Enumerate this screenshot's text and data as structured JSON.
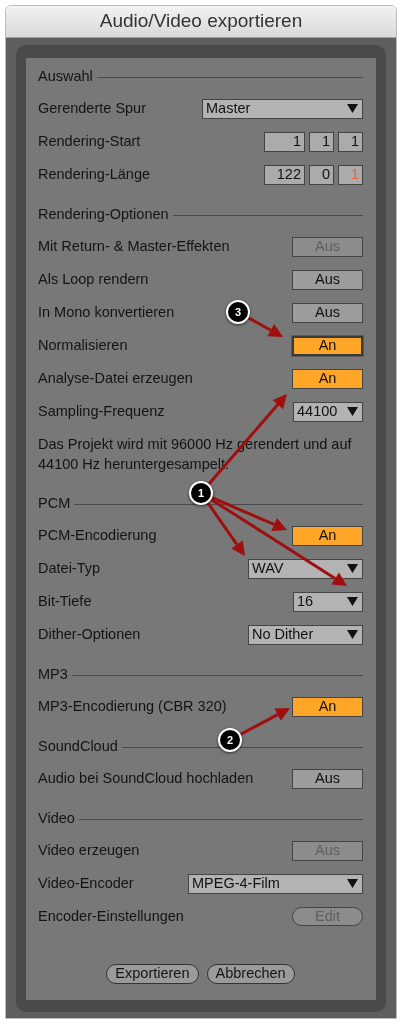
{
  "window": {
    "title": "Audio/Video exportieren"
  },
  "sections": [
    {
      "title": "Auswahl",
      "rows": [
        {
          "kind": "dropdown",
          "label": "Gerenderte Spur",
          "value": "Master"
        },
        {
          "kind": "numbers",
          "label": "Rendering-Start",
          "fields": [
            {
              "value": "1",
              "selected": false
            },
            {
              "value": "1",
              "selected": false
            },
            {
              "value": "1",
              "selected": false
            }
          ]
        },
        {
          "kind": "numbers",
          "label": "Rendering-Länge",
          "fields": [
            {
              "value": "122",
              "selected": false
            },
            {
              "value": "0",
              "selected": false
            },
            {
              "value": "1",
              "selected": true
            }
          ]
        }
      ]
    },
    {
      "title": "Rendering-Optionen",
      "rows": [
        {
          "kind": "toggle",
          "label": "Mit Return- & Master-Effekten",
          "value": "Aus",
          "on": false,
          "disabled": true,
          "focused": false
        },
        {
          "kind": "toggle",
          "label": "Als Loop rendern",
          "value": "Aus",
          "on": false,
          "disabled": false,
          "focused": false
        },
        {
          "kind": "toggle",
          "label": "In Mono konvertieren",
          "value": "Aus",
          "on": false,
          "disabled": false,
          "focused": false
        },
        {
          "kind": "toggle",
          "label": "Normalisieren",
          "value": "An",
          "on": true,
          "disabled": false,
          "focused": true
        },
        {
          "kind": "toggle",
          "label": "Analyse-Datei erzeugen",
          "value": "An",
          "on": true,
          "disabled": false,
          "focused": false
        },
        {
          "kind": "dropdown",
          "label": "Sampling-Frequenz",
          "value": "44100"
        },
        {
          "kind": "note",
          "text": "Das Projekt wird mit 96000 Hz gerendert und auf 44100 Hz heruntergesampelt."
        }
      ]
    },
    {
      "title": "PCM",
      "rows": [
        {
          "kind": "toggle",
          "label": "PCM-Encodierung",
          "value": "An",
          "on": true,
          "disabled": false,
          "focused": false
        },
        {
          "kind": "dropdown",
          "label": "Datei-Typ",
          "value": "WAV"
        },
        {
          "kind": "dropdown",
          "label": "Bit-Tiefe",
          "value": "16"
        },
        {
          "kind": "dropdown",
          "label": "Dither-Optionen",
          "value": "No Dither"
        }
      ]
    },
    {
      "title": "MP3",
      "rows": [
        {
          "kind": "toggle",
          "label": "MP3-Encodierung (CBR 320)",
          "value": "An",
          "on": true,
          "disabled": false,
          "focused": false
        }
      ]
    },
    {
      "title": "SoundCloud",
      "rows": [
        {
          "kind": "toggle",
          "label": "Audio bei SoundCloud hochladen",
          "value": "Aus",
          "on": false,
          "disabled": false,
          "focused": false
        }
      ]
    },
    {
      "title": "Video",
      "rows": [
        {
          "kind": "toggle",
          "label": "Video erzeugen",
          "value": "Aus",
          "on": false,
          "disabled": true,
          "focused": false
        },
        {
          "kind": "dropdown",
          "label": "Video-Encoder",
          "value": "MPEG-4-Film"
        },
        {
          "kind": "button",
          "label": "Encoder-Einstellungen",
          "value": "Edit",
          "disabled": true
        }
      ]
    }
  ],
  "buttons": [
    {
      "label": "Exportieren"
    },
    {
      "label": "Abbrechen"
    }
  ],
  "annotations": [
    {
      "number": "1"
    },
    {
      "number": "2"
    },
    {
      "number": "3"
    }
  ]
}
